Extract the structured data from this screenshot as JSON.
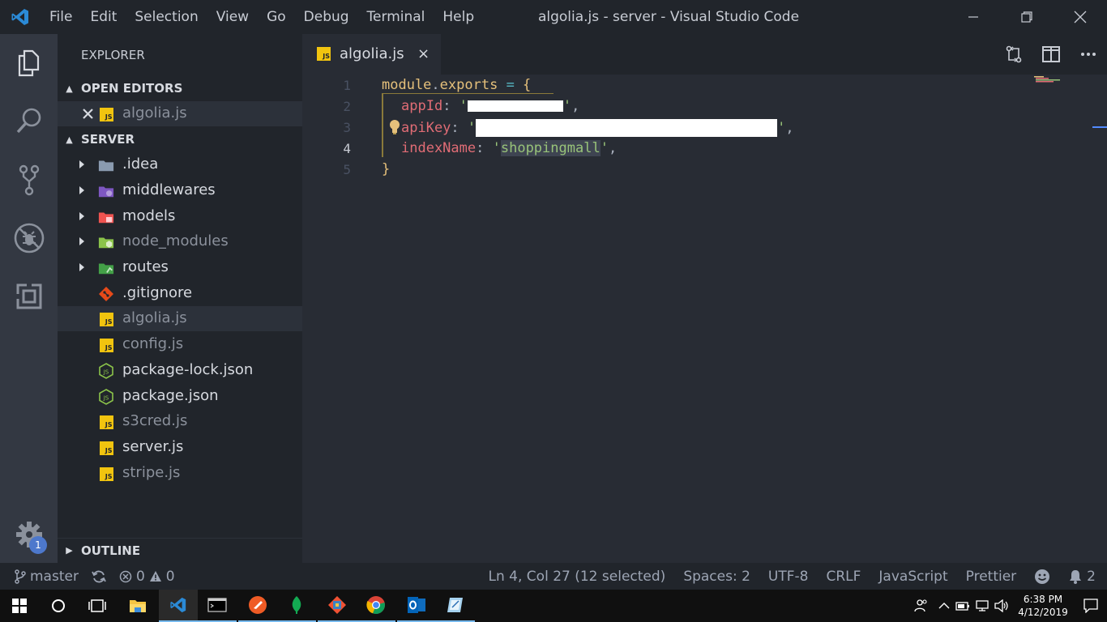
{
  "window": {
    "title": "algolia.js - server - Visual Studio Code",
    "menu": [
      "File",
      "Edit",
      "Selection",
      "View",
      "Go",
      "Debug",
      "Terminal",
      "Help"
    ]
  },
  "activity_bar": {
    "icons": [
      "explorer-icon",
      "search-icon",
      "source-control-icon",
      "debug-icon",
      "extensions-icon",
      "settings-gear-icon"
    ],
    "settings_badge": "1"
  },
  "sidebar": {
    "title": "EXPLORER",
    "open_editors": {
      "header": "OPEN EDITORS",
      "items": [
        {
          "name": "algolia.js",
          "icon": "js-file-icon"
        }
      ]
    },
    "folder": {
      "header": "SERVER",
      "items": [
        {
          "name": ".idea",
          "type": "folder",
          "icon": "folder-icon",
          "color": "#8a9bb0"
        },
        {
          "name": "middlewares",
          "type": "folder",
          "icon": "folder-middleware-icon",
          "color": "#7e57c2"
        },
        {
          "name": "models",
          "type": "folder",
          "icon": "folder-models-icon",
          "color": "#ef5350"
        },
        {
          "name": "node_modules",
          "type": "folder",
          "icon": "folder-node-icon",
          "color": "#8bc34a"
        },
        {
          "name": "routes",
          "type": "folder",
          "icon": "folder-routes-icon",
          "color": "#43a047"
        },
        {
          "name": ".gitignore",
          "type": "file",
          "icon": "git-icon",
          "color": "#e64a19"
        },
        {
          "name": "algolia.js",
          "type": "file",
          "icon": "js-file-icon",
          "color": "#f1c40f"
        },
        {
          "name": "config.js",
          "type": "file",
          "icon": "js-file-icon",
          "color": "#f1c40f"
        },
        {
          "name": "package-lock.json",
          "type": "file",
          "icon": "nodejs-icon",
          "color": "#8bc34a"
        },
        {
          "name": "package.json",
          "type": "file",
          "icon": "nodejs-icon",
          "color": "#8bc34a"
        },
        {
          "name": "s3cred.js",
          "type": "file",
          "icon": "js-file-icon",
          "color": "#f1c40f"
        },
        {
          "name": "server.js",
          "type": "file",
          "icon": "js-file-icon",
          "color": "#f1c40f"
        },
        {
          "name": "stripe.js",
          "type": "file",
          "icon": "js-file-icon",
          "color": "#f1c40f"
        }
      ]
    },
    "outline_header": "OUTLINE"
  },
  "editor": {
    "tab": {
      "label": "algolia.js",
      "close": "×"
    },
    "line_numbers": [
      "1",
      "2",
      "3",
      "4",
      "5"
    ],
    "code": {
      "l1_obj": "module",
      "l1_dot": ".",
      "l1_exp": "exports",
      "l1_eq": " = ",
      "l1_brace": "{",
      "l2_key": "appId",
      "l3_key": "apiKey",
      "l4_key": "indexName",
      "l4_val": "shoppingmall",
      "colon": ": ",
      "quote": "'",
      "comma": ",",
      "l5_brace": "}"
    }
  },
  "statusbar": {
    "branch": "master",
    "errors": "0",
    "warnings": "0",
    "cursor": "Ln 4, Col 27 (12 selected)",
    "spaces": "Spaces: 2",
    "encoding": "UTF-8",
    "eol": "CRLF",
    "language": "JavaScript",
    "formatter": "Prettier",
    "notifications": "2"
  },
  "taskbar": {
    "time": "6:38 PM",
    "date": "4/12/2019"
  },
  "colors": {
    "accent": "#528bff",
    "badge": "#4d78cc",
    "js_yellow": "#f1c40f"
  }
}
